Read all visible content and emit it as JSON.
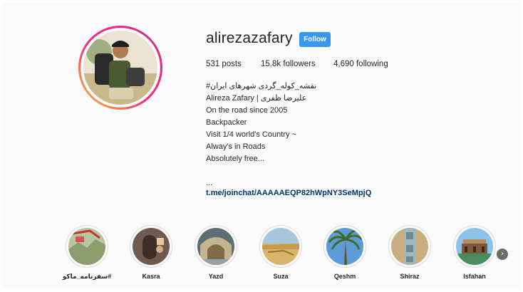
{
  "profile": {
    "username": "alirezazafary",
    "follow_label": "Follow",
    "stats": {
      "posts": "531 posts",
      "followers": "15.8k followers",
      "following": "4,690 following"
    },
    "bio": {
      "line1": "نقشه_کوله_گردی شهرهای ایران#",
      "line2": "Alireza Zafary | علیرضا ظفری",
      "line3": "On the road since 2005",
      "line4": "Backpacker",
      "line5": "Visit 1/4 world's Country ~",
      "line6": "Alway's in Roads",
      "line7": "Absolutely free...",
      "line8": "..."
    },
    "link": "t.me/joinchat/AAAAAEQP82hWpNY3SeMpjQ"
  },
  "highlights": [
    {
      "label": "سفرنامه_ماکو#"
    },
    {
      "label": "Kasra"
    },
    {
      "label": "Yazd"
    },
    {
      "label": "Suza"
    },
    {
      "label": "Qeshm"
    },
    {
      "label": "Shiraz"
    },
    {
      "label": "Isfahan"
    }
  ],
  "colors": {
    "follow_button": "#3897f0",
    "link": "#003569",
    "ring_gradient": [
      "#f9ce34",
      "#ee2a7b",
      "#c13584"
    ]
  },
  "icons": {
    "next": "chevron-right-icon"
  }
}
